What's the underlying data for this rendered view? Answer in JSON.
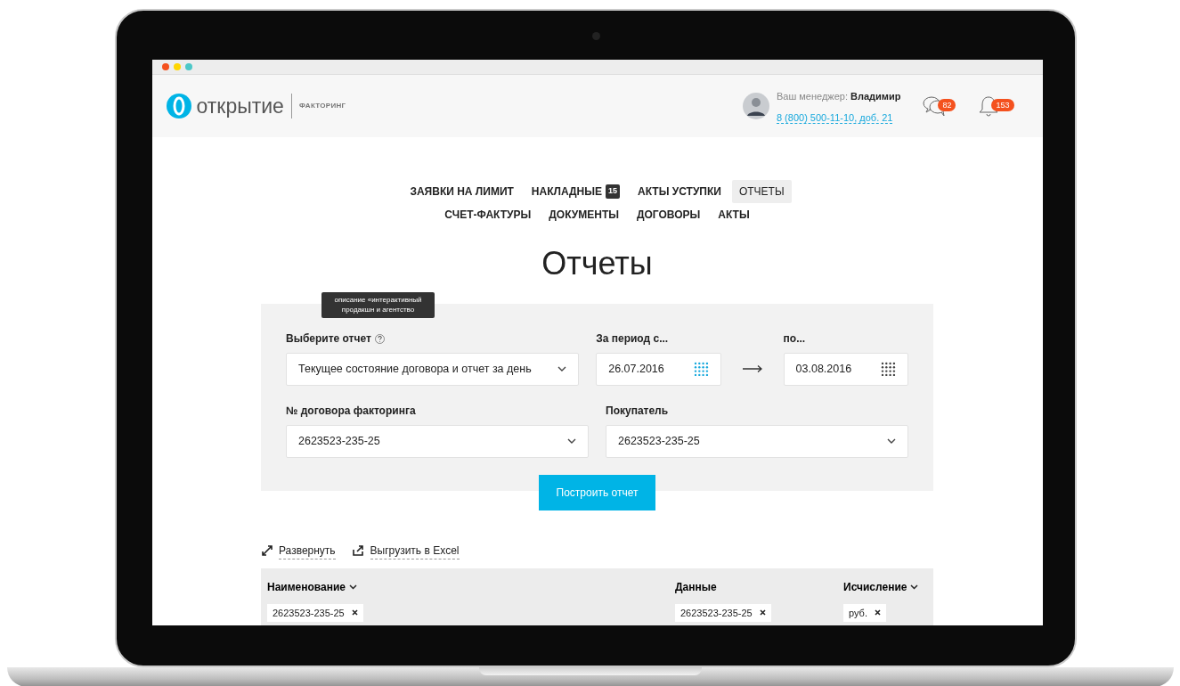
{
  "browser": {
    "controls": [
      {
        "color": "#f4511e"
      },
      {
        "color": "#ffd600"
      },
      {
        "color": "#4dc8c8"
      }
    ]
  },
  "header": {
    "logo": {
      "name": "открытие",
      "product": "ФАКТОРИНГ"
    },
    "manager": {
      "label": "Ваш менеджер:",
      "name": "Владимир",
      "phone": "8 (800) 500-11-10, доб. 21"
    },
    "messages": {
      "count": "82"
    },
    "notifications": {
      "count": "153"
    }
  },
  "nav": {
    "rows": [
      [
        {
          "label": "ЗАЯВКИ НА ЛИМИТ",
          "selected": false
        },
        {
          "label": "НАКЛАДНЫЕ",
          "badge": "15",
          "selected": false
        },
        {
          "label": "АКТЫ УСТУПКИ",
          "selected": false
        },
        {
          "label": "ОТЧЕТЫ",
          "selected": true
        }
      ],
      [
        {
          "label": "СЧЕТ-ФАКТУРЫ",
          "selected": false
        },
        {
          "label": "ДОКУМЕНТЫ",
          "selected": false
        },
        {
          "label": "ДОГОВОРЫ",
          "selected": false
        },
        {
          "label": "АКТЫ",
          "selected": false
        }
      ]
    ]
  },
  "title": "Отчеты",
  "form": {
    "tooltip": "описание «интерактивный продакшн и агентство",
    "rows": [
      [
        {
          "kind": "select",
          "label": "Выберите отчет",
          "help": true,
          "value": "Текущее состояние договора и отчет за день"
        },
        {
          "kind": "date",
          "label": "За период с...",
          "value": "26.07.2016",
          "highlighted": true
        },
        {
          "kind": "date",
          "label": "по...",
          "value": "03.08.2016",
          "highlighted": false
        }
      ],
      [
        {
          "kind": "select",
          "label": "№ договора факторинга",
          "help": false,
          "value": "2623523-235-25"
        },
        {
          "kind": "select",
          "label": "Покупатель",
          "help": false,
          "value": "2623523-235-25"
        }
      ]
    ],
    "button": "Построить отчет"
  },
  "actions": [
    {
      "kind": "expand",
      "label": "Развернуть"
    },
    {
      "kind": "export",
      "label": "Выгрузить в Excel"
    }
  ],
  "table": {
    "columns": [
      {
        "label": "Наименование",
        "sortable": true,
        "filters": [
          "2623523-235-25"
        ]
      },
      {
        "label": "Данные",
        "sortable": false,
        "filters": [
          "2623523-235-25"
        ]
      },
      {
        "label": "Исчисление",
        "sortable": true,
        "filters": [
          "руб."
        ]
      }
    ]
  }
}
